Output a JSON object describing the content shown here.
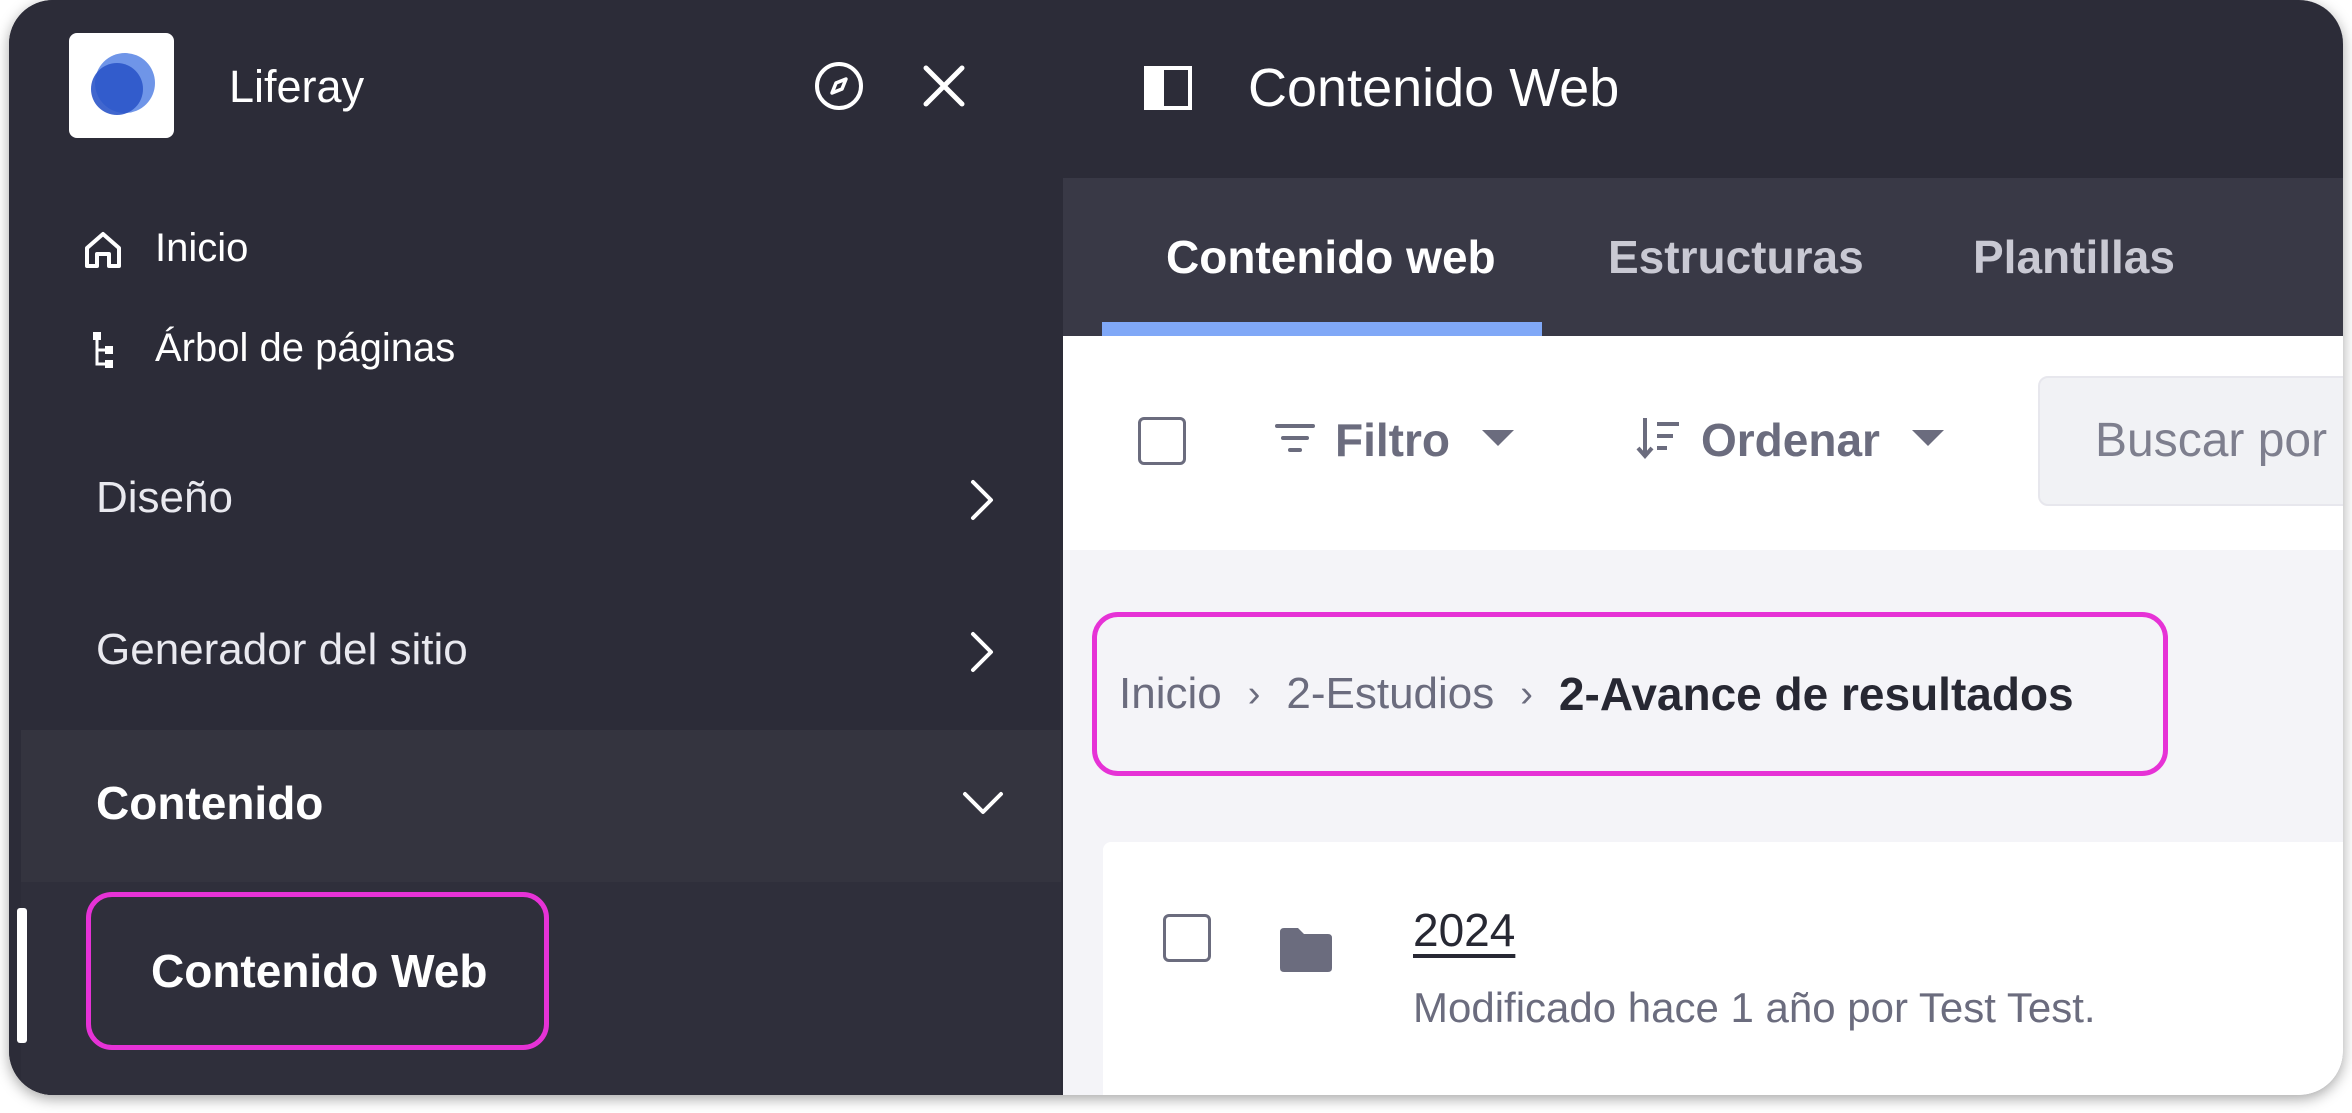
{
  "sidebar": {
    "app_name": "Liferay",
    "nav": [
      {
        "label": "Inicio",
        "icon": "home-icon"
      },
      {
        "label": "Árbol de páginas",
        "icon": "page-tree-icon"
      }
    ],
    "sections": [
      {
        "label": "Diseño",
        "icon": "chevron-right-icon"
      },
      {
        "label": "Generador del sitio",
        "icon": "chevron-right-icon"
      },
      {
        "label": "Contenido",
        "icon": "chevron-down-icon",
        "expanded": true
      }
    ],
    "active_subitem": "Contenido Web"
  },
  "header": {
    "title": "Contenido Web",
    "icons": [
      "compass-icon",
      "close-icon",
      "panel-toggle-icon"
    ]
  },
  "tabs": [
    {
      "label": "Contenido web",
      "active": true
    },
    {
      "label": "Estructuras",
      "active": false
    },
    {
      "label": "Plantillas",
      "active": false
    }
  ],
  "toolbar": {
    "filter_label": "Filtro",
    "order_label": "Ordenar",
    "search_placeholder": "Buscar por"
  },
  "breadcrumb": {
    "items": [
      "Inicio",
      "2-Estudios"
    ],
    "current": "2-Avance de resultados"
  },
  "list": [
    {
      "title": "2024",
      "meta": "Modificado hace 1 año por Test Test.",
      "icon": "folder-icon"
    }
  ],
  "colors": {
    "sidebar_bg": "#2c2c38",
    "tabbar_bg": "#393946",
    "tab_underline": "#80a8f7",
    "highlight": "#e632d6",
    "logo_blue": "#2e5aac"
  }
}
